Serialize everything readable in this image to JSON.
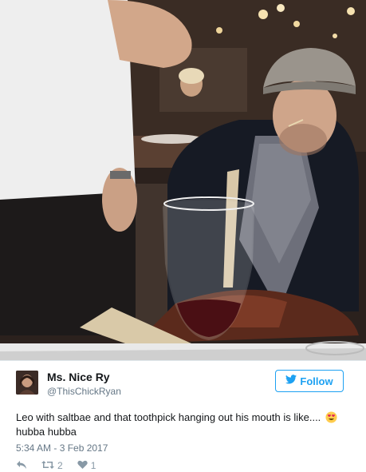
{
  "tweet": {
    "author_name": "Ms. Nice Ry",
    "author_handle": "@ThisChickRyan",
    "follow_label": "Follow",
    "text_before_emoji": "Leo with saltbae and that toothpick hanging out his mouth is like....",
    "text_after_emoji": "hubba hubba",
    "timestamp": "5:34 AM - 3 Feb 2017",
    "retweet_count": "2",
    "like_count": "1"
  },
  "icons": {
    "follow": "twitter-bird-icon",
    "emoji": "heart-eyes-emoji-icon",
    "reply": "reply-icon",
    "retweet": "retweet-icon",
    "like": "heart-icon"
  },
  "colors": {
    "accent": "#1da1f2",
    "muted": "#657786",
    "text": "#14171a"
  }
}
